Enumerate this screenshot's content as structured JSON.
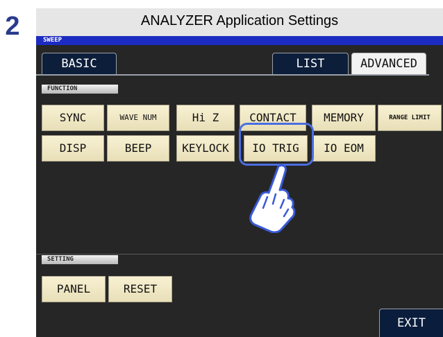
{
  "step_number": "2",
  "header": {
    "title": "ANALYZER Application Settings"
  },
  "mode_bar": {
    "label": "SWEEP"
  },
  "tabs": [
    {
      "label": "BASIC",
      "active": false
    },
    {
      "label": "LIST",
      "active": false
    },
    {
      "label": "ADVANCED",
      "active": true
    }
  ],
  "sections": {
    "function": "FUNCTION",
    "setting": "SETTING"
  },
  "function_buttons": [
    "SYNC",
    "WAVE NUM",
    "Hi Z",
    "CONTACT",
    "MEMORY",
    "RANGE LIMIT",
    "DISP",
    "BEEP",
    "KEYLOCK",
    "IO TRIG",
    "IO EOM"
  ],
  "setting_buttons": [
    "PANEL",
    "RESET"
  ],
  "exit_label": "EXIT",
  "highlighted_button": "IO TRIG",
  "colors": {
    "mode_bar": "#1c2bc2",
    "screen_bg": "#262626",
    "button_face": "#f2ebcb",
    "highlight": "#4a6ee0",
    "step_number": "#2a3a8c"
  }
}
